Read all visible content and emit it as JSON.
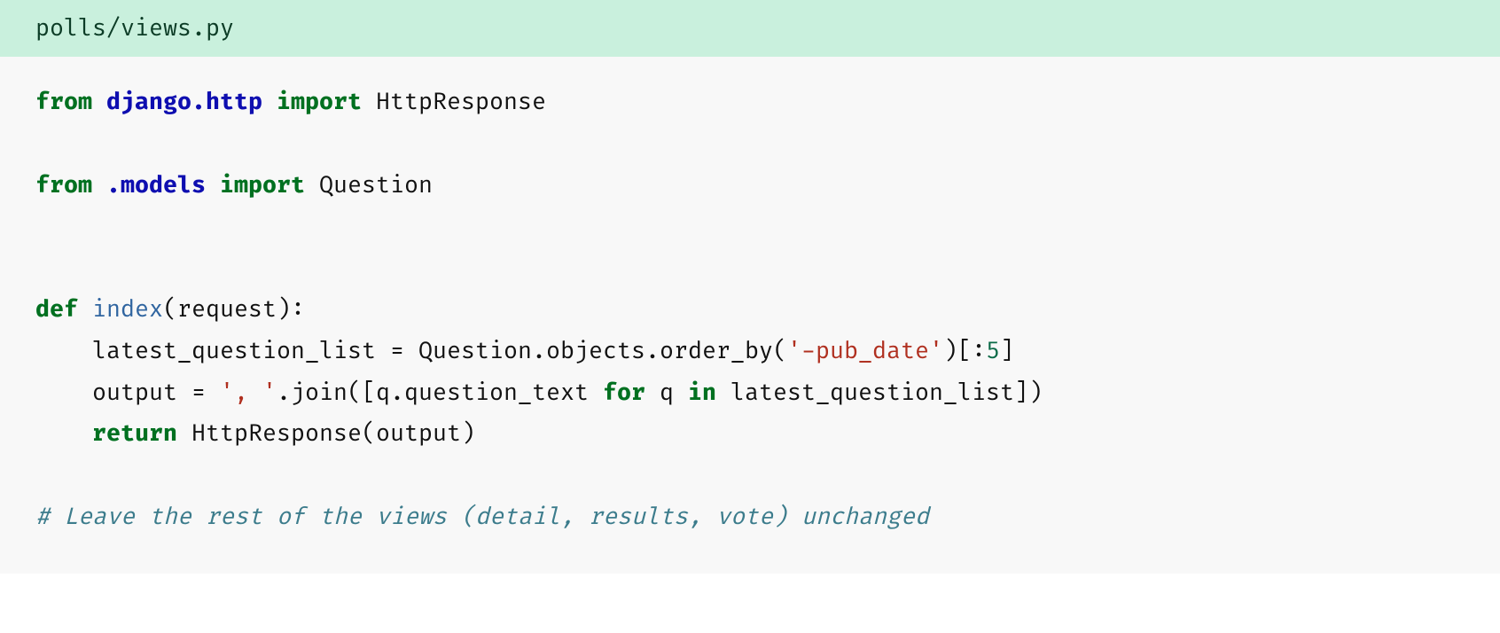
{
  "filename": "polls/views.py",
  "code": {
    "l1": {
      "a": "from ",
      "b": "django.http",
      "c": " import",
      "d": " HttpResponse"
    },
    "l2": {
      "a": "from ",
      "b": ".models",
      "c": " import",
      "d": " Question"
    },
    "l3a": "def ",
    "l3b": "index",
    "l3c": "(request):",
    "l4a": "    latest_question_list = Question.objects.order_by(",
    "l4b": "'-pub_date'",
    "l4c": ")[:",
    "l4d": "5",
    "l4e": "]",
    "l5a": "    output = ",
    "l5b": "', '",
    "l5c": ".join([q.question_text ",
    "l5d": "for",
    "l5e": " q ",
    "l5f": "in",
    "l5g": " latest_question_list])",
    "l6a": "    ",
    "l6b": "return",
    "l6c": " HttpResponse(output)",
    "l7": "# Leave the rest of the views (detail, results, vote) unchanged"
  }
}
